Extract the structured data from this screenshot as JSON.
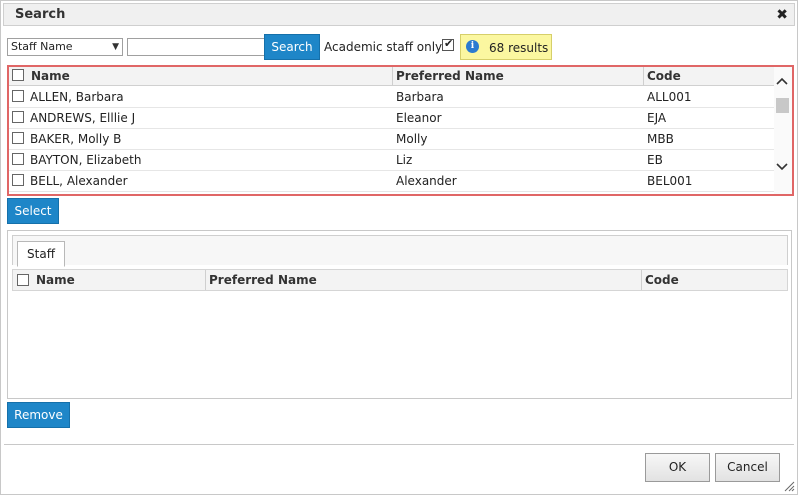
{
  "dialog": {
    "title": "Search",
    "close_symbol": "✖"
  },
  "search": {
    "field_select": "Staff Name",
    "input_value": "",
    "button_label": "Search",
    "academic_label": "Academic staff only?",
    "academic_checked": true,
    "results_text": "68 results"
  },
  "results": {
    "headers": {
      "name": "Name",
      "preferred": "Preferred Name",
      "code": "Code"
    },
    "rows": [
      {
        "name": "ALLEN, Barbara",
        "preferred": "Barbara",
        "code": "ALL001"
      },
      {
        "name": "ANDREWS, Elllie J",
        "preferred": "Eleanor",
        "code": "EJA"
      },
      {
        "name": "BAKER, Molly B",
        "preferred": "Molly",
        "code": "MBB"
      },
      {
        "name": "BAYTON, Elizabeth",
        "preferred": "Liz",
        "code": "EB"
      },
      {
        "name": "BELL, Alexander",
        "preferred": "Alexander",
        "code": "BEL001"
      }
    ]
  },
  "select_button": "Select",
  "staff": {
    "tab_label": "Staff",
    "headers": {
      "name": "Name",
      "preferred": "Preferred Name",
      "code": "Code"
    }
  },
  "remove_button": "Remove",
  "footer": {
    "ok_label": "OK",
    "cancel_label": "Cancel"
  },
  "colors": {
    "accent": "#1e86c8",
    "badge": "#fbf7a0",
    "grid_border": "#e06666"
  }
}
